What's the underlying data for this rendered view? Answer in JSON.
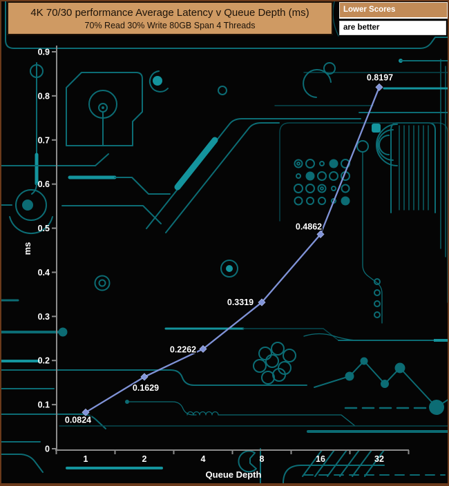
{
  "header": {
    "title": "4K 70/30 performance Average Latency v Queue Depth (ms)",
    "subtitle": "70% Read 30% Write 80GB Span 4 Threads"
  },
  "note": {
    "line1": "Lower Scores",
    "line2": "are better"
  },
  "chart_data": {
    "type": "line",
    "title": "4K 70/30 performance Average Latency v Queue Depth (ms)",
    "subtitle": "70% Read 30% Write 80GB Span 4 Threads",
    "categories": [
      "1",
      "2",
      "4",
      "8",
      "16",
      "32"
    ],
    "values": [
      0.0824,
      0.1629,
      0.2262,
      0.3319,
      0.4862,
      0.8197
    ],
    "point_labels": [
      "0.0824",
      "0.1629",
      "0.2262",
      "0.3319",
      "0.4862",
      "0.8197"
    ],
    "xlabel": "Queue Depth",
    "ylabel": "ms",
    "ylim": [
      0,
      0.9
    ],
    "ytick_step": 0.1,
    "yticks": [
      "0",
      "0.1",
      "0.2",
      "0.3",
      "0.4",
      "0.5",
      "0.6",
      "0.7",
      "0.8",
      "0.9"
    ],
    "grid": false,
    "legend": "none",
    "marker": "diamond",
    "label_offsets": [
      [
        -11,
        15
      ],
      [
        2,
        20
      ],
      [
        -29,
        5
      ],
      [
        -31,
        4
      ],
      [
        -17,
        -7
      ],
      [
        1,
        -10
      ]
    ]
  },
  "colors": {
    "background": "#050505",
    "border_brown": "#6b3a1b",
    "banner_bg": "#cf9a63",
    "banner_text": "#1b1209",
    "note_header_bg": "#c28b57",
    "trace": "#0c6c74",
    "trace_bright": "#14949d",
    "trace_dim": "#074950",
    "line": "#8093d8",
    "axis": "#8c8c8c"
  }
}
